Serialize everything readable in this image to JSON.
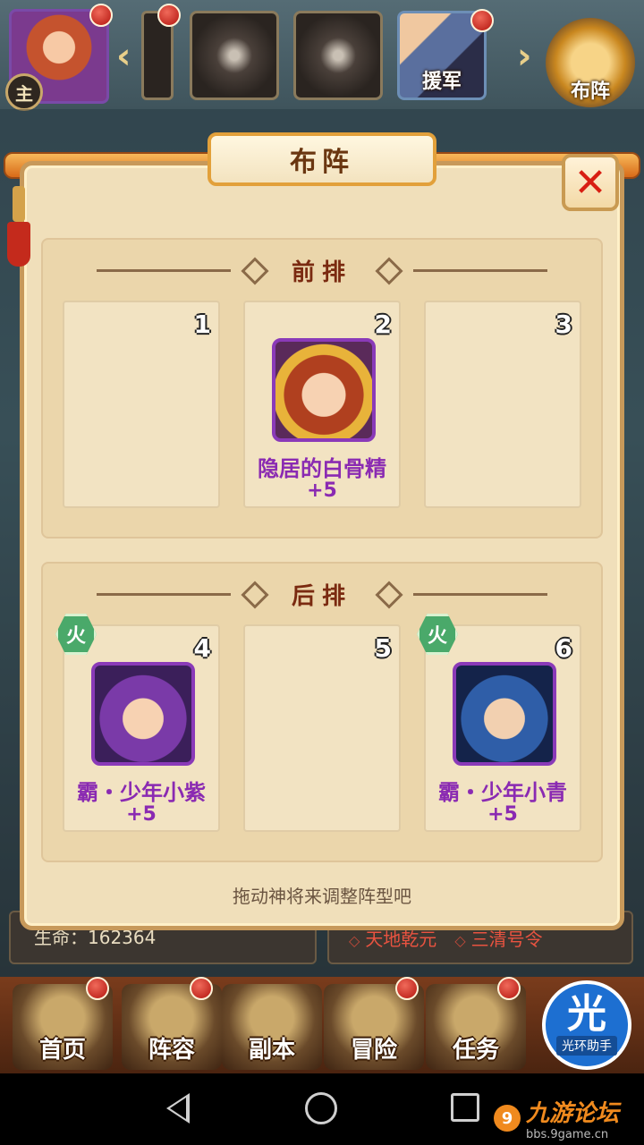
{
  "topbar": {
    "main_badge": "主",
    "helper_label": "援军",
    "formation_label": "布阵"
  },
  "modal": {
    "title": "布阵",
    "close_symbol": "✕",
    "front_label": "前排",
    "back_label": "后排",
    "slots": [
      {
        "num": "1",
        "name": "",
        "bonus": ""
      },
      {
        "num": "2",
        "name": "隐居的白骨精",
        "bonus": "+5"
      },
      {
        "num": "3",
        "name": "",
        "bonus": ""
      },
      {
        "num": "4",
        "name": "霸・少年小紫",
        "bonus": "+5",
        "badge": "火"
      },
      {
        "num": "5",
        "name": "",
        "bonus": ""
      },
      {
        "num": "6",
        "name": "霸・少年小青",
        "bonus": "+5",
        "badge": "火"
      }
    ],
    "hint": "拖动神将来调整阵型吧"
  },
  "info": {
    "hp": "生命：162364",
    "tag1": "天地乾元",
    "tag2": "三清号令"
  },
  "nav": {
    "items": [
      "首页",
      "阵容",
      "副本",
      "冒险",
      "任务"
    ]
  },
  "overlay": {
    "helper_char": "光",
    "helper_text": "光环助手"
  },
  "watermark": {
    "title": "九游论坛",
    "url": "bbs.9game.cn"
  },
  "colors": {
    "accent_purple": "#8a2ab2",
    "close_red": "#d81e12",
    "title_brown": "#6a3610"
  }
}
